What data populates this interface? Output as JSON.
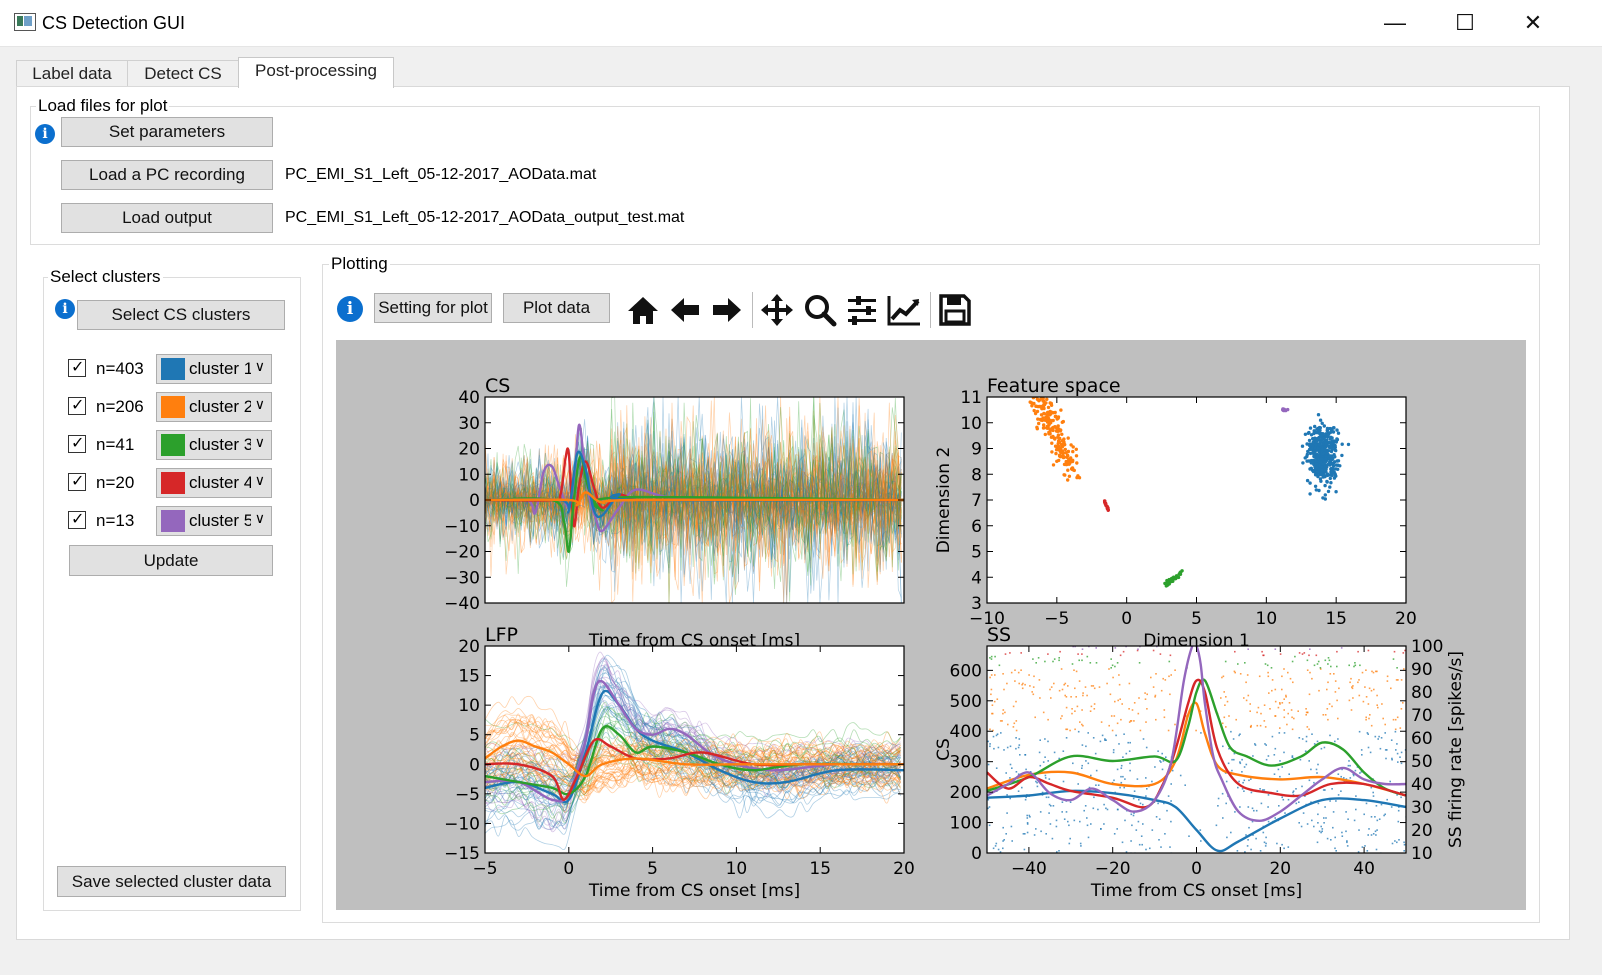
{
  "window": {
    "title": "CS Detection GUI"
  },
  "window_controls": {
    "minimize": "—",
    "maximize": "☐",
    "close": "✕"
  },
  "tabs": [
    {
      "label": "Label data",
      "active": false
    },
    {
      "label": "Detect CS",
      "active": false
    },
    {
      "label": "Post-processing",
      "active": true
    }
  ],
  "load_files": {
    "group_title": "Load files for plot",
    "info_symbol": "i",
    "set_parameters_label": "Set parameters",
    "load_recording_label": "Load a PC recording",
    "recording_filename": "PC_EMI_S1_Left_05-12-2017_AOData.mat",
    "load_output_label": "Load output",
    "output_filename": "PC_EMI_S1_Left_05-12-2017_AOData_output_test.mat"
  },
  "select_clusters": {
    "group_title": "Select clusters",
    "select_button_label": "Select CS clusters",
    "clusters": [
      {
        "count": "n=403",
        "name": "cluster 1",
        "color": "#1f77b4",
        "checked": true
      },
      {
        "count": "n=206",
        "name": "cluster 2",
        "color": "#ff7f0e",
        "checked": true
      },
      {
        "count": "n=41",
        "name": "cluster 3",
        "color": "#2ca02c",
        "checked": true
      },
      {
        "count": "n=20",
        "name": "cluster 4",
        "color": "#d62728",
        "checked": true
      },
      {
        "count": "n=13",
        "name": "cluster 5",
        "color": "#9467bd",
        "checked": true
      }
    ],
    "update_label": "Update",
    "save_label": "Save selected cluster data"
  },
  "plotting": {
    "group_title": "Plotting",
    "setting_label": "Setting for plot",
    "plot_data_label": "Plot data",
    "toolbar_icons": [
      "home-icon",
      "back-arrow-icon",
      "forward-arrow-icon",
      "pan-icon",
      "zoom-icon",
      "configure-subplots-icon",
      "edit-axis-icon",
      "save-icon"
    ]
  },
  "chart_data": [
    {
      "type": "line",
      "title": "CS",
      "xlabel": "Time from CS onset [ms]",
      "ylabel": "",
      "xlim": [
        -5,
        20
      ],
      "ylim": [
        -40,
        40
      ],
      "yticks": [
        40,
        30,
        20,
        10,
        0,
        -10,
        -20,
        -30,
        -40
      ],
      "series": [
        {
          "color": "#9467bd",
          "x": [
            -5,
            -2.5,
            -2,
            -1.5,
            -1,
            -0.5,
            0,
            0.3,
            0.6,
            0.9,
            1.2,
            1.6,
            2,
            3,
            4,
            6,
            10,
            20
          ],
          "y": [
            0,
            0,
            -5,
            11,
            13,
            4,
            -3,
            5,
            29,
            16,
            2,
            -7,
            -12,
            -3,
            4,
            1,
            0,
            0
          ]
        },
        {
          "color": "#d62728",
          "x": [
            -5,
            -1,
            -0.5,
            -0.2,
            0,
            0.3,
            0.6,
            1,
            1.5,
            2,
            3,
            4,
            6,
            20
          ],
          "y": [
            0,
            0,
            2,
            16,
            18,
            -10,
            5,
            15,
            5,
            -3,
            2,
            0,
            0,
            0
          ]
        },
        {
          "color": "#2ca02c",
          "x": [
            -5,
            -1,
            -0.3,
            0,
            0.3,
            0.7,
            1.2,
            2,
            3,
            20
          ],
          "y": [
            0,
            0,
            -8,
            -20,
            0,
            17,
            4,
            -4,
            1,
            0
          ]
        },
        {
          "color": "#1f77b4",
          "x": [
            -5,
            -0.5,
            0,
            0.5,
            1,
            1.5,
            2,
            3,
            4,
            20
          ],
          "y": [
            0,
            0,
            -4,
            18,
            12,
            -4,
            -6,
            2,
            0,
            0
          ]
        },
        {
          "color": "#ff7f0e",
          "x": [
            -5,
            0,
            0.5,
            1,
            2,
            4,
            20
          ],
          "y": [
            0,
            0,
            -2,
            3,
            -1,
            0,
            0
          ]
        }
      ]
    },
    {
      "type": "scatter",
      "title": "Feature space",
      "xlabel": "Dimension 1",
      "ylabel": "Dimension 2",
      "xlim": [
        -10,
        20
      ],
      "ylim": [
        3,
        11
      ],
      "xticks": [
        -10,
        -5,
        0,
        5,
        10,
        15,
        20
      ],
      "yticks": [
        11,
        10,
        9,
        8,
        7,
        6,
        5,
        4,
        3
      ],
      "clusters": [
        {
          "color": "#1f77b4",
          "center": [
            14,
            8.7
          ],
          "spread": [
            1.0,
            1.1
          ],
          "n": 403
        },
        {
          "color": "#ff7f0e",
          "center": [
            -5,
            9.2
          ],
          "spread": [
            0.8,
            1.2
          ],
          "n": 206
        },
        {
          "color": "#2ca02c",
          "center": [
            3.5,
            4.0
          ],
          "spread": [
            0.3,
            0.1
          ],
          "n": 41
        },
        {
          "color": "#d62728",
          "center": [
            -1.5,
            6.9
          ],
          "spread": [
            0.1,
            0.15
          ],
          "n": 20
        },
        {
          "color": "#9467bd",
          "center": [
            11.3,
            10.5
          ],
          "spread": [
            0.15,
            0.05
          ],
          "n": 13
        }
      ]
    },
    {
      "type": "line",
      "title": "LFP",
      "xlabel": "Time from CS onset [ms]",
      "ylabel": "",
      "xlim": [
        -5,
        20
      ],
      "ylim": [
        -15,
        20
      ],
      "xticks": [
        -5,
        0,
        5,
        10,
        15,
        20
      ],
      "yticks": [
        20,
        15,
        10,
        5,
        0,
        -5,
        -10,
        -15
      ],
      "series": [
        {
          "color": "#1f77b4",
          "x": [
            -5,
            -3,
            -1,
            0,
            1,
            2,
            3,
            4,
            5,
            7,
            9,
            11,
            13,
            16,
            20
          ],
          "y": [
            -4,
            -3,
            -5,
            -6,
            2,
            12,
            10,
            6,
            4,
            2,
            -1,
            -3,
            -3,
            -1,
            -1
          ]
        },
        {
          "color": "#9467bd",
          "x": [
            -5,
            -3,
            -1,
            0,
            1,
            1.5,
            2,
            3,
            4,
            5,
            6,
            7,
            9,
            12,
            16,
            20
          ],
          "y": [
            -3,
            -3,
            -6,
            -5,
            4,
            12,
            14,
            10,
            6,
            5,
            6,
            5,
            1,
            -1,
            0,
            0
          ]
        },
        {
          "color": "#2ca02c",
          "x": [
            -5,
            -3,
            -1,
            0,
            1,
            2,
            3,
            4,
            5,
            7,
            9,
            11,
            14,
            20
          ],
          "y": [
            -2,
            -3,
            -4,
            -5,
            -2,
            6,
            5,
            2,
            3,
            2,
            0,
            -1,
            0,
            0
          ]
        },
        {
          "color": "#d62728",
          "x": [
            -5,
            -3,
            -1,
            -0.3,
            0.5,
            1.5,
            2.5,
            4,
            6,
            8,
            11,
            14,
            20
          ],
          "y": [
            0,
            0,
            -2,
            -6,
            -2,
            4,
            3,
            1,
            1,
            2,
            0,
            0,
            0
          ]
        },
        {
          "color": "#ff7f0e",
          "x": [
            -5,
            -4,
            -3,
            -2,
            -1,
            0,
            1,
            2,
            4,
            7,
            10,
            14,
            20
          ],
          "y": [
            1,
            3,
            4,
            3,
            2,
            0,
            -2,
            0,
            1,
            0,
            0,
            0,
            0
          ]
        }
      ]
    },
    {
      "type": "scatter",
      "title": "SS",
      "xlabel": "Time from CS onset [ms]",
      "ylabel": "CS",
      "y2label": "SS firing rate [spikes/s]",
      "xlim": [
        -50,
        50
      ],
      "ylim": [
        0,
        680
      ],
      "y2lim": [
        10,
        100
      ],
      "xticks": [
        -40,
        -20,
        0,
        20,
        40
      ],
      "yticks": [
        600,
        500,
        400,
        300,
        200,
        100,
        0
      ],
      "y2ticks": [
        100,
        90,
        80,
        70,
        60,
        50,
        40,
        30,
        20,
        10
      ],
      "series": [
        {
          "color": "#1f77b4",
          "x": [
            -50,
            -40,
            -30,
            -20,
            -10,
            -5,
            0,
            5,
            10,
            20,
            30,
            40,
            50
          ],
          "y": [
            34,
            35,
            37,
            36,
            33,
            30,
            20,
            11,
            15,
            25,
            33,
            33,
            30
          ]
        },
        {
          "color": "#ff7f0e",
          "x": [
            -50,
            -40,
            -30,
            -20,
            -10,
            -5,
            -2,
            0,
            2,
            5,
            10,
            20,
            30,
            40,
            50
          ],
          "y": [
            38,
            44,
            45,
            40,
            40,
            50,
            70,
            75,
            62,
            48,
            44,
            42,
            43,
            40,
            35
          ]
        },
        {
          "color": "#2ca02c",
          "x": [
            -50,
            -40,
            -30,
            -20,
            -10,
            -5,
            -2,
            0,
            2,
            5,
            8,
            12,
            18,
            25,
            30,
            35,
            40,
            45,
            50
          ],
          "y": [
            37,
            43,
            52,
            50,
            52,
            50,
            65,
            80,
            85,
            70,
            56,
            52,
            48,
            52,
            58,
            55,
            45,
            38,
            35
          ]
        },
        {
          "color": "#d62728",
          "x": [
            -50,
            -45,
            -40,
            -35,
            -30,
            -20,
            -12,
            -8,
            -5,
            -2,
            0,
            2,
            5,
            10,
            18,
            25,
            32,
            40,
            50
          ],
          "y": [
            45,
            38,
            43,
            40,
            37,
            34,
            30,
            40,
            55,
            75,
            85,
            80,
            55,
            40,
            36,
            35,
            40,
            40,
            35
          ]
        },
        {
          "color": "#9467bd",
          "x": [
            -50,
            -45,
            -40,
            -35,
            -30,
            -25,
            -20,
            -15,
            -10,
            -6,
            -3,
            -1,
            0,
            1,
            2,
            4,
            6,
            10,
            15,
            20,
            25,
            30,
            35,
            40,
            45,
            50
          ],
          "y": [
            35,
            40,
            45,
            36,
            33,
            38,
            33,
            28,
            33,
            50,
            85,
            100,
            100,
            92,
            75,
            52,
            42,
            28,
            24,
            28,
            35,
            42,
            47,
            42,
            40,
            40
          ]
        }
      ]
    }
  ]
}
